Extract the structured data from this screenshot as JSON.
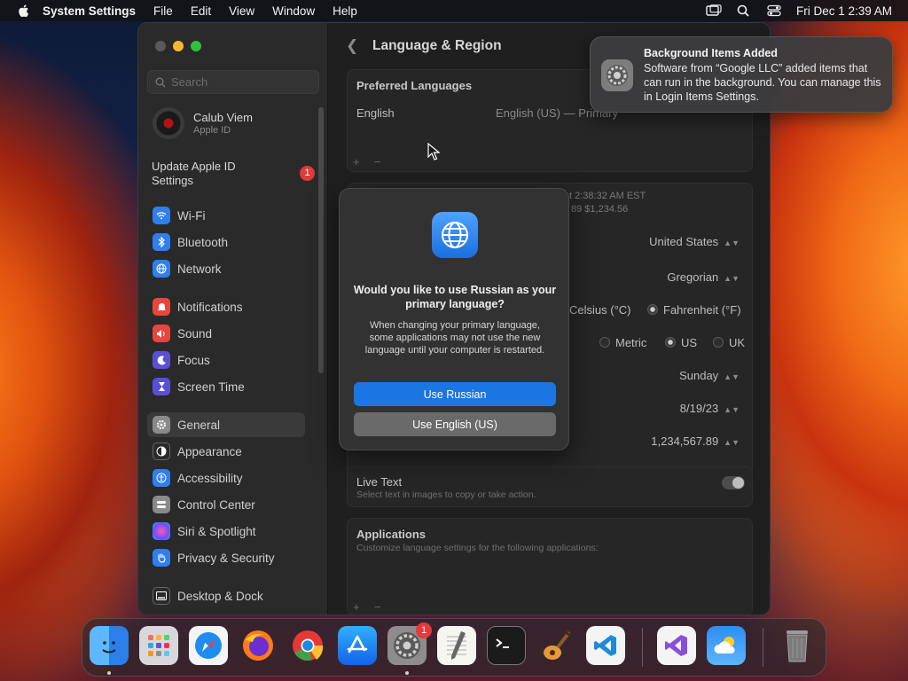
{
  "menubar": {
    "app_name": "System Settings",
    "items": [
      "File",
      "Edit",
      "View",
      "Window",
      "Help"
    ],
    "clock": "Fri Dec 1  2:39 AM"
  },
  "sidebar": {
    "search_placeholder": "Search",
    "account": {
      "name": "Calub Viem",
      "subtitle": "Apple ID"
    },
    "update": {
      "label": "Update Apple ID Settings",
      "badge": "1"
    },
    "items": [
      {
        "label": "Wi-Fi",
        "color": "#2f7fef"
      },
      {
        "label": "Bluetooth",
        "color": "#2f7fef"
      },
      {
        "label": "Network",
        "color": "#2f7fef"
      },
      {
        "label": "Notifications",
        "color": "#e5473e"
      },
      {
        "label": "Sound",
        "color": "#e5473e"
      },
      {
        "label": "Focus",
        "color": "#5b4fd6"
      },
      {
        "label": "Screen Time",
        "color": "#5b4fd6"
      },
      {
        "label": "General",
        "color": "#8a8a8a"
      },
      {
        "label": "Appearance",
        "color": "#2a2a2a"
      },
      {
        "label": "Accessibility",
        "color": "#2f7fef"
      },
      {
        "label": "Control Center",
        "color": "#8a8a8a"
      },
      {
        "label": "Siri & Spotlight",
        "color": "#b04fd6"
      },
      {
        "label": "Privacy & Security",
        "color": "#2f7fef"
      },
      {
        "label": "Desktop & Dock",
        "color": "#2a2a2a"
      }
    ]
  },
  "content": {
    "title": "Language & Region",
    "preferred_languages": {
      "title": "Preferred Languages",
      "language": "English",
      "detail": "English (US) — Primary"
    },
    "format_preview": {
      "line1": "t 2:38:32 AM EST",
      "line2": "89     $1,234.56"
    },
    "region": "United States",
    "calendar": "Gregorian",
    "temperature": {
      "celsius": "Celsius (°C)",
      "fahrenheit": "Fahrenheit (°F)"
    },
    "measurement": {
      "metric": "Metric",
      "us": "US",
      "uk": "UK"
    },
    "first_day": "Sunday",
    "date_format": "8/19/23",
    "number_format": "1,234,567.89",
    "live_text": {
      "title": "Live Text",
      "subtitle": "Select text in images to copy or take action."
    },
    "applications": {
      "title": "Applications",
      "subtitle": "Customize language settings for the following applications:"
    },
    "plus": "+",
    "minus": "−"
  },
  "dialog": {
    "title": "Would you like to use Russian as your primary language?",
    "message": "When changing your primary language, some applications may not use the new language until your computer is restarted.",
    "primary_button": "Use Russian",
    "secondary_button": "Use English (US)"
  },
  "notification": {
    "title": "Background Items Added",
    "body": "Software from “Google LLC” added items that can run in the background. You can manage this in Login Items Settings."
  },
  "dock": {
    "badge_settings": "1",
    "apps": [
      "finder-icon",
      "launchpad-icon",
      "safari-icon",
      "firefox-icon",
      "chrome-icon",
      "app-store-icon",
      "system-settings-icon",
      "textedit-icon",
      "terminal-icon",
      "garageband-icon",
      "vscode-icon",
      "visual-studio-icon",
      "weather-icon",
      "trash-icon"
    ]
  }
}
